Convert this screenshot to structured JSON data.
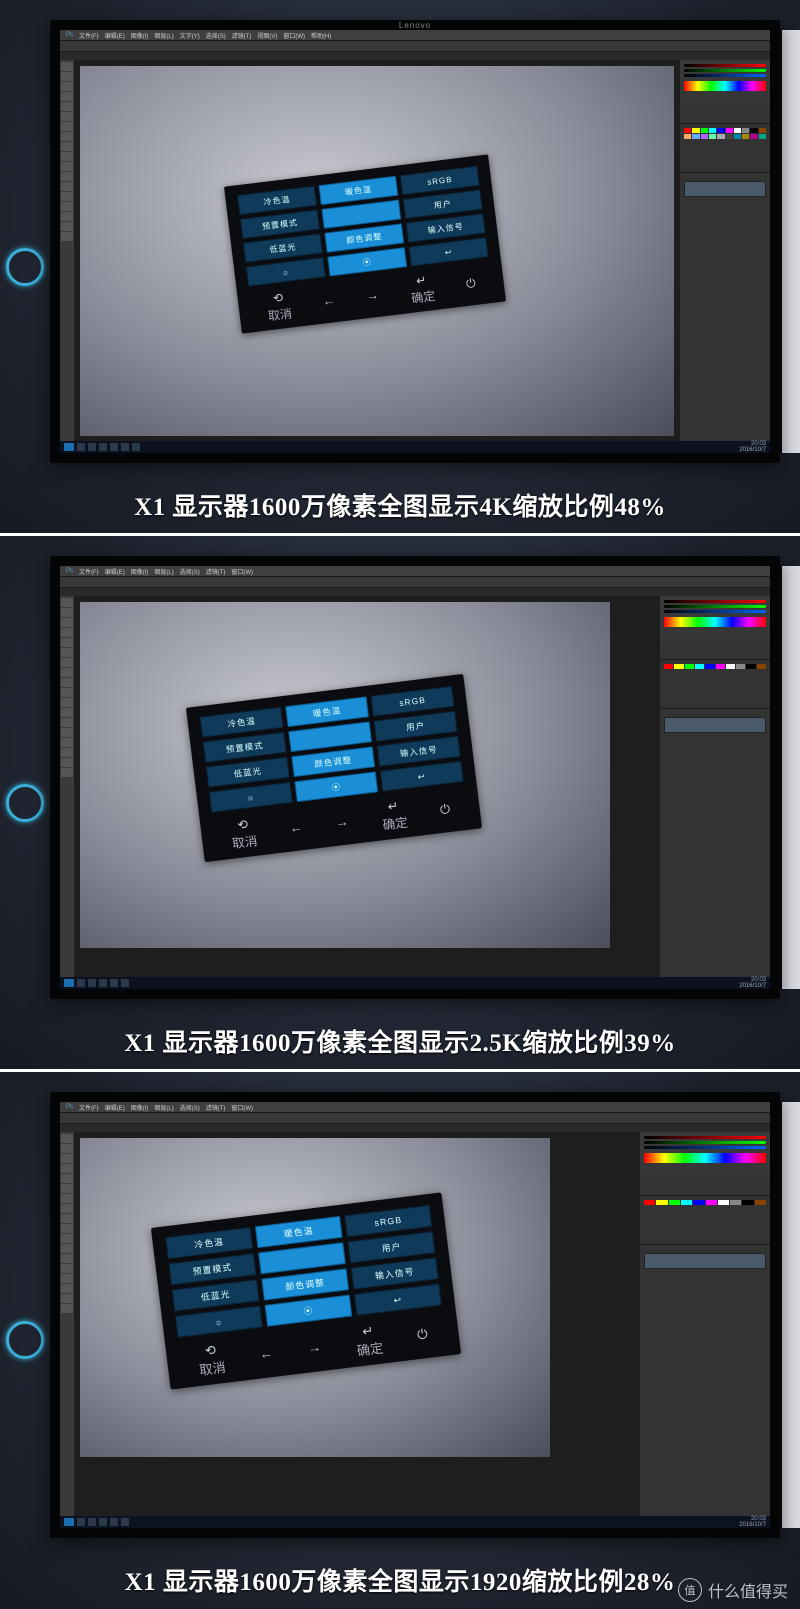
{
  "panels": [
    {
      "caption": "X1 显示器1600万像素全图显示4K缩放比例48%"
    },
    {
      "caption": "X1 显示器1600万像素全图显示2.5K缩放比例39%"
    },
    {
      "caption": "X1 显示器1600万像素全图显示1920缩放比例28%"
    }
  ],
  "monitor_brand": "Lenovo",
  "ps_menu": [
    "文件(F)",
    "编辑(E)",
    "图像(I)",
    "图层(L)",
    "文字(Y)",
    "选择(S)",
    "滤镜(T)",
    "视图(V)",
    "窗口(W)",
    "帮助(H)"
  ],
  "osd": {
    "tiles": [
      {
        "label": "冷色温",
        "style": "dim"
      },
      {
        "label": "暖色温",
        "style": "bri"
      },
      {
        "label": "sRGB",
        "style": "dim"
      },
      {
        "label": "预置模式",
        "style": "dim"
      },
      {
        "label": "",
        "style": "bri"
      },
      {
        "label": "用户",
        "style": "dim"
      },
      {
        "label": "低蓝光",
        "style": "dim"
      },
      {
        "label": "颜色调整",
        "style": "bri"
      },
      {
        "label": "输入信号",
        "style": "dim"
      },
      {
        "label": "☼",
        "style": "dim"
      },
      {
        "label": "⦿",
        "style": "bri"
      },
      {
        "label": "↩",
        "style": "dim"
      }
    ],
    "nav": {
      "cancel": "取消",
      "confirm": "确定"
    }
  },
  "taskbar": {
    "time": "20:03",
    "date": "2016/10/7"
  },
  "watermark": {
    "badge": "值",
    "text": "什么值得买"
  }
}
